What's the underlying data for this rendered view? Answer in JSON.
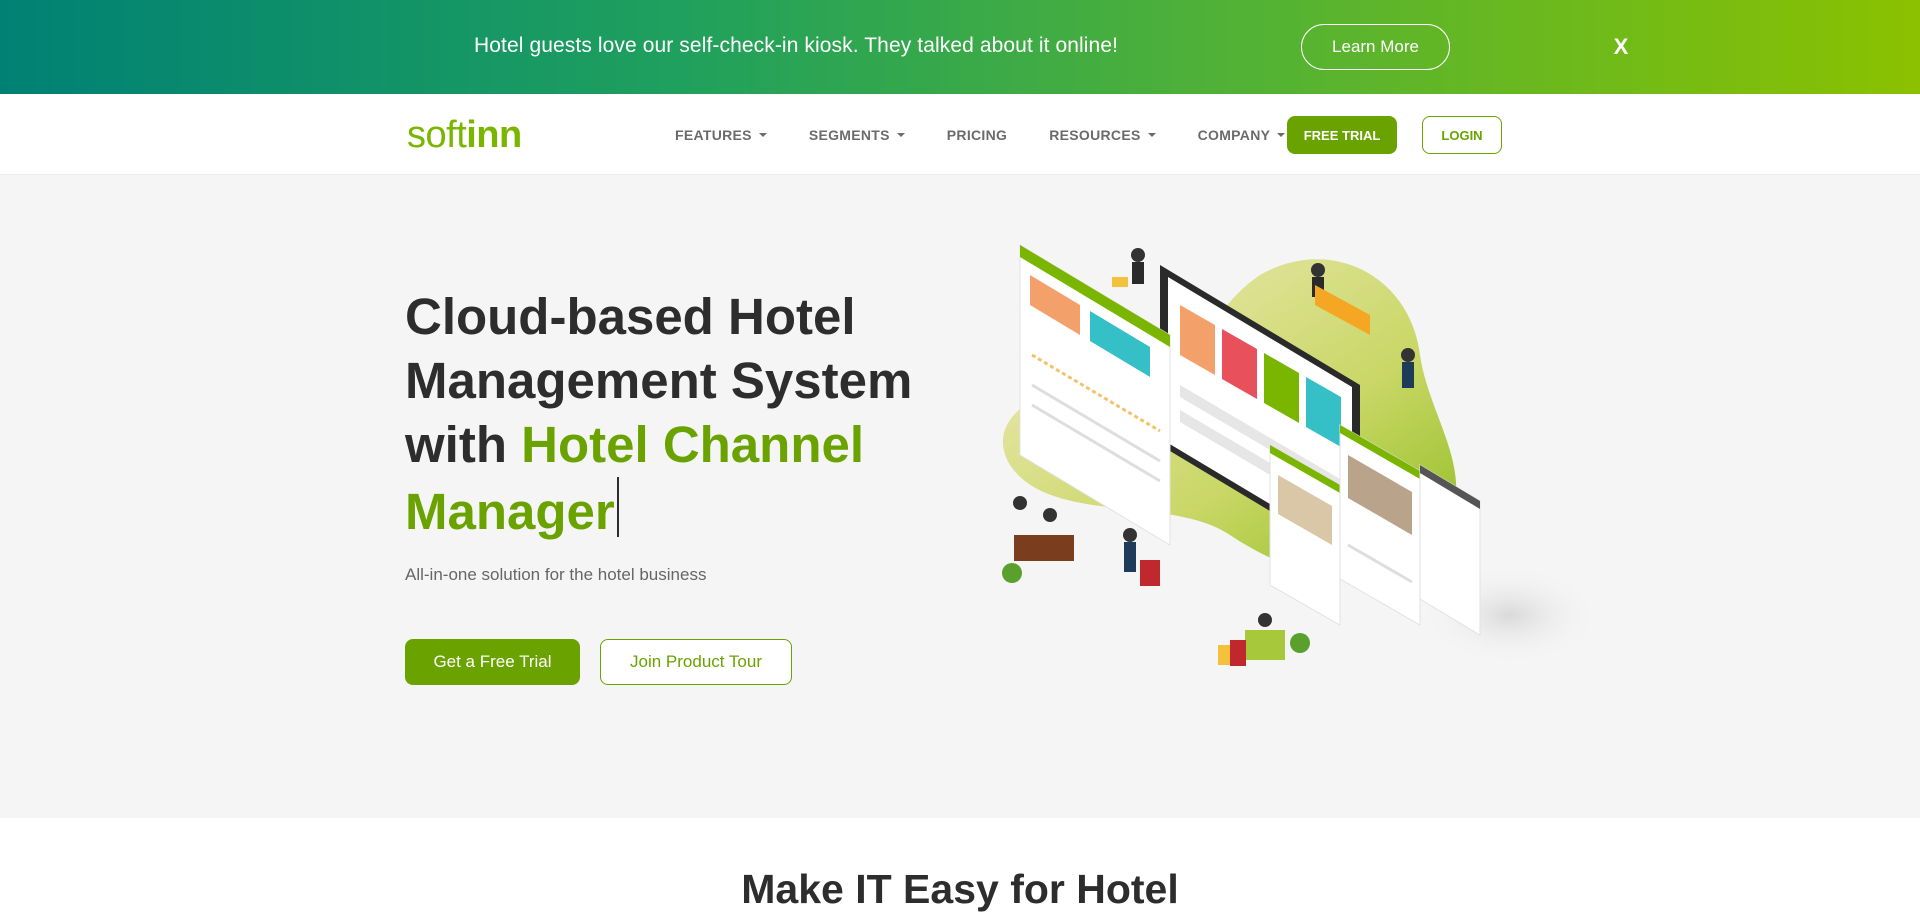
{
  "promo": {
    "text": "Hotel guests love our self-check-in kiosk. They talked about it online!",
    "button": "Learn More",
    "close": "X"
  },
  "header": {
    "logo_soft": "soft",
    "logo_inn": "inn",
    "nav": [
      {
        "label": "FEATURES",
        "dropdown": true
      },
      {
        "label": "SEGMENTS",
        "dropdown": true
      },
      {
        "label": "PRICING",
        "dropdown": false
      },
      {
        "label": "RESOURCES",
        "dropdown": true
      },
      {
        "label": "COMPANY",
        "dropdown": true
      }
    ],
    "trial_button": "FREE TRIAL",
    "login_button": "LOGIN"
  },
  "hero": {
    "title_line1": "Cloud-based Hotel",
    "title_line2": "Management System",
    "title_with": "with ",
    "title_accent1": "Hotel Channel",
    "title_accent2": "Manager",
    "subtitle": "All-in-one solution for the hotel business",
    "primary_button": "Get a Free Trial",
    "secondary_button": "Join Product Tour"
  },
  "section": {
    "title": "Make IT Easy for Hotel"
  },
  "colors": {
    "brand_green": "#6aa300",
    "logo_green": "#7ab500",
    "promo_gradient_start": "#008174",
    "promo_gradient_end": "#8bc100"
  }
}
